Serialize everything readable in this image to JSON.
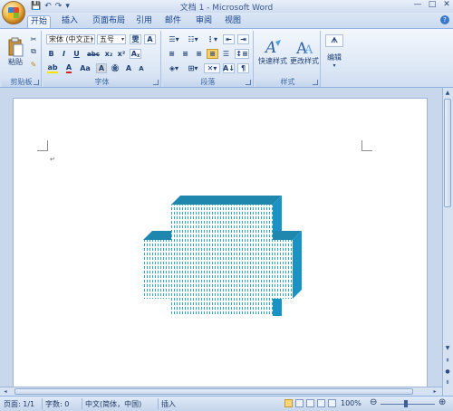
{
  "titlebar": {
    "title": "文档 1 - Microsoft Word",
    "qat": [
      "💾",
      "↶",
      "↷",
      "▾"
    ],
    "controls": [
      "—",
      "□",
      "✕"
    ]
  },
  "tabs": [
    "开始",
    "插入",
    "页面布局",
    "引用",
    "邮件",
    "审阅",
    "视图"
  ],
  "active_tab": "开始",
  "ribbon": {
    "clipboard": {
      "paste_label": "粘贴",
      "group_label": "剪贴板"
    },
    "font": {
      "font_name": "宋体 (中文正)",
      "font_size": "五号",
      "group_label": "字体",
      "buttons_row2": [
        "B",
        "I",
        "U",
        "abc",
        "x₂",
        "x²"
      ],
      "buttons_row3": [
        "ab",
        "A",
        "Aa",
        "A",
        "㊎",
        "A",
        "A"
      ]
    },
    "paragraph": {
      "group_label": "段落"
    },
    "styles": {
      "quick_styles_label": "快速样式",
      "change_styles_label": "更改样式",
      "group_label": "样式"
    },
    "editing": {
      "edit_label": "编辑",
      "find_glyph": "ᗑ"
    }
  },
  "document": {
    "paragraph_mark": "↵"
  },
  "statusbar": {
    "page": "页面: 1/1",
    "words": "字数: 0",
    "language": "中文(简体，中国)",
    "mode": "插入",
    "zoom": "100%",
    "zoom_value": 100
  },
  "colors": {
    "shape_front": "#2aa7c9",
    "shape_top": "#1f86ad",
    "shape_side": "#1a93c4",
    "font_color": "#e02020",
    "highlight": "#ffe300"
  }
}
